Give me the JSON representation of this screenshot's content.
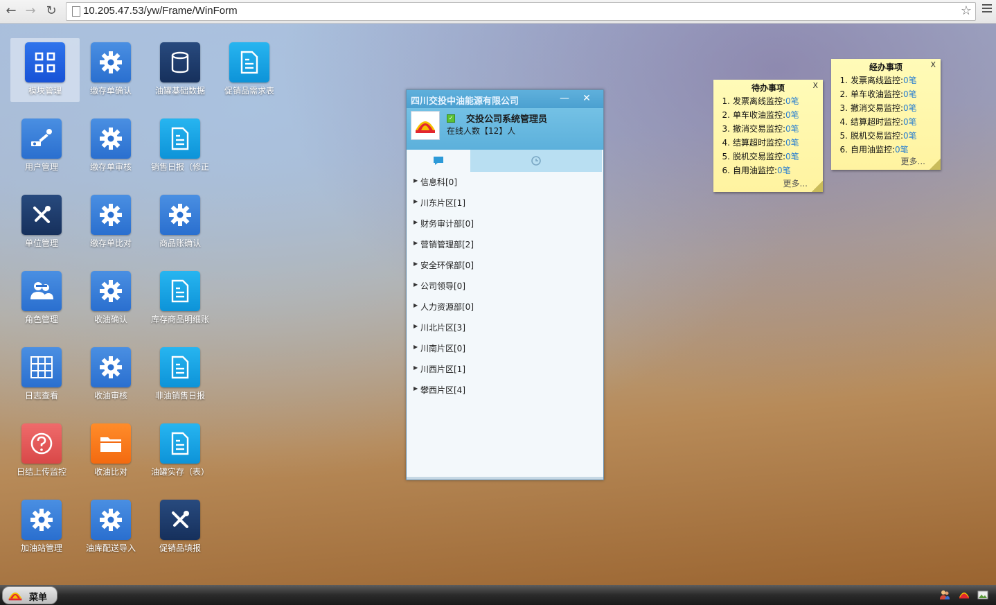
{
  "browser": {
    "url": "10.205.47.53/yw/Frame/WinForm"
  },
  "desktop_icons": [
    {
      "label": "模块管理",
      "icon": "grid-icon",
      "color": "#1f56c8"
    },
    {
      "label": "用户管理",
      "icon": "wrench-icon",
      "color": "#2a6fcf"
    },
    {
      "label": "单位管理",
      "icon": "tools-icon",
      "color": "#16305c"
    },
    {
      "label": "角色管理",
      "icon": "users-icon",
      "color": "#2a6fcf"
    },
    {
      "label": "日志查看",
      "icon": "sudoku-icon",
      "color": "#2a6fcf"
    },
    {
      "label": "日结上传监控",
      "icon": "question-icon",
      "color": "#d94848"
    },
    {
      "label": "加油站管理",
      "icon": "gear-icon",
      "color": "#2a6fcf"
    },
    {
      "label": "缴存单确认",
      "icon": "gear-icon",
      "color": "#2a6fcf"
    },
    {
      "label": "缴存单审核",
      "icon": "gear-icon",
      "color": "#2a6fcf"
    },
    {
      "label": "缴存单比对",
      "icon": "gear-icon",
      "color": "#2a6fcf"
    },
    {
      "label": "收油确认",
      "icon": "gear-icon",
      "color": "#2a6fcf"
    },
    {
      "label": "收油审核",
      "icon": "gear-icon",
      "color": "#2a6fcf"
    },
    {
      "label": "收油比对",
      "icon": "folder-icon",
      "color": "#f36a10"
    },
    {
      "label": "油库配送导入",
      "icon": "gear-icon",
      "color": "#2a6fcf"
    },
    {
      "label": "油罐基础数据",
      "icon": "database-icon",
      "color": "#16305c"
    },
    {
      "label": "销售日报（修正",
      "icon": "document-icon",
      "color": "#0d93d8"
    },
    {
      "label": "商品账确认",
      "icon": "gear-icon",
      "color": "#2a6fcf"
    },
    {
      "label": "库存商品明细账",
      "icon": "document-icon",
      "color": "#0d93d8"
    },
    {
      "label": "非油销售日报",
      "icon": "document-icon",
      "color": "#0d93d8"
    },
    {
      "label": "油罐实存（表）",
      "icon": "document-icon",
      "color": "#0d93d8"
    },
    {
      "label": "促销品填报",
      "icon": "tools-icon",
      "color": "#16305c"
    },
    {
      "label": "促销品需求表",
      "icon": "document-icon",
      "color": "#0d93d8"
    }
  ],
  "chat": {
    "title": "四川交投中油能源有限公司",
    "minimize": "—",
    "close": "✕",
    "user_name": "交投公司系统管理员",
    "online_count": "在线人数【12】人",
    "groups": [
      "信息科[0]",
      "川东片区[1]",
      "财务审计部[0]",
      "营销管理部[2]",
      "安全环保部[0]",
      "公司领导[0]",
      "人力资源部[0]",
      "川北片区[3]",
      "川南片区[0]",
      "川西片区[1]",
      "攀西片区[4]"
    ]
  },
  "notes": {
    "todo": {
      "title": "待办事项",
      "close": "X",
      "items": [
        {
          "num": "1.",
          "label": "发票离线监控:",
          "value": "0笔"
        },
        {
          "num": "2.",
          "label": "单车收油监控:",
          "value": "0笔"
        },
        {
          "num": "3.",
          "label": "撤消交易监控:",
          "value": "0笔"
        },
        {
          "num": "4.",
          "label": "结算超时监控:",
          "value": "0笔"
        },
        {
          "num": "5.",
          "label": "脱机交易监控:",
          "value": "0笔"
        },
        {
          "num": "6.",
          "label": "自用油监控:",
          "value": "0笔"
        }
      ],
      "more": "更多..."
    },
    "done": {
      "title": "经办事项",
      "close": "X",
      "items": [
        {
          "num": "1.",
          "label": "发票离线监控:",
          "value": "0笔"
        },
        {
          "num": "2.",
          "label": "单车收油监控:",
          "value": "0笔"
        },
        {
          "num": "3.",
          "label": "撤消交易监控:",
          "value": "0笔"
        },
        {
          "num": "4.",
          "label": "结算超时监控:",
          "value": "0笔"
        },
        {
          "num": "5.",
          "label": "脱机交易监控:",
          "value": "0笔"
        },
        {
          "num": "6.",
          "label": "自用油监控:",
          "value": "0笔"
        }
      ],
      "more": "更多..."
    }
  },
  "taskbar": {
    "start_label": "菜单"
  }
}
